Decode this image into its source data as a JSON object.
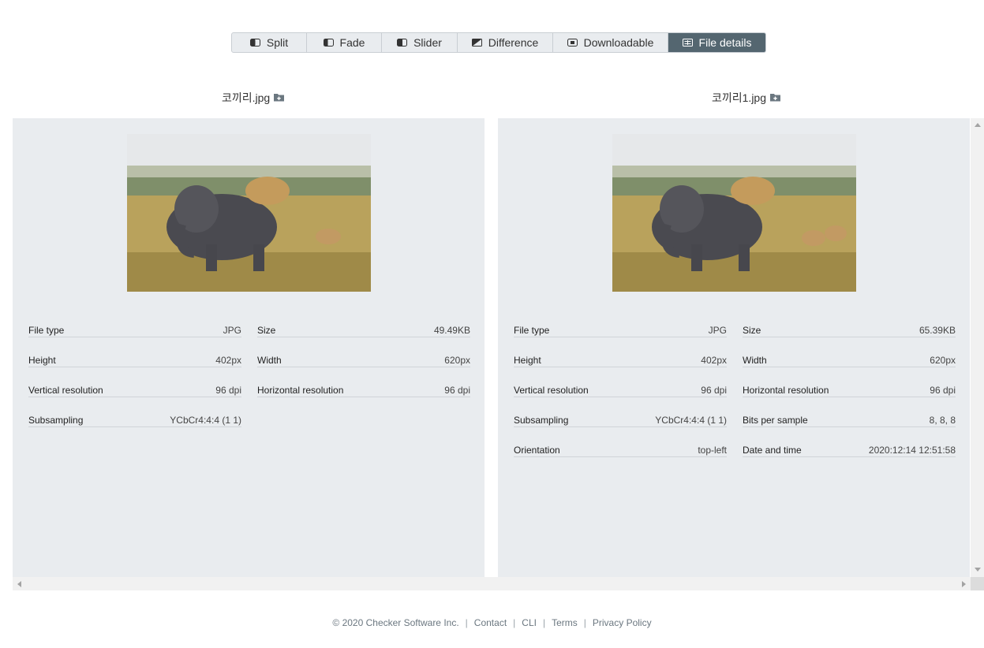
{
  "toolbar": {
    "tabs": [
      {
        "label": "Split",
        "icon": "split-icon"
      },
      {
        "label": "Fade",
        "icon": "fade-icon"
      },
      {
        "label": "Slider",
        "icon": "slider-icon"
      },
      {
        "label": "Difference",
        "icon": "difference-icon"
      },
      {
        "label": "Downloadable",
        "icon": "downloadable-icon"
      },
      {
        "label": "File details",
        "icon": "file-details-icon",
        "active": true
      }
    ],
    "active_color": "#546670"
  },
  "left": {
    "filename": "코끼리.jpg",
    "details": {
      "file_type": {
        "label": "File type",
        "value": "JPG"
      },
      "size": {
        "label": "Size",
        "value": "49.49KB"
      },
      "height": {
        "label": "Height",
        "value": "402px"
      },
      "width": {
        "label": "Width",
        "value": "620px"
      },
      "vres": {
        "label": "Vertical resolution",
        "value": "96 dpi"
      },
      "hres": {
        "label": "Horizontal resolution",
        "value": "96 dpi"
      },
      "subsampling": {
        "label": "Subsampling",
        "value": "YCbCr4:4:4 (1 1)"
      }
    }
  },
  "right": {
    "filename": "코끼리1.jpg",
    "details": {
      "file_type": {
        "label": "File type",
        "value": "JPG"
      },
      "size": {
        "label": "Size",
        "value": "65.39KB"
      },
      "height": {
        "label": "Height",
        "value": "402px"
      },
      "width": {
        "label": "Width",
        "value": "620px"
      },
      "vres": {
        "label": "Vertical resolution",
        "value": "96 dpi"
      },
      "hres": {
        "label": "Horizontal resolution",
        "value": "96 dpi"
      },
      "subsampling": {
        "label": "Subsampling",
        "value": "YCbCr4:4:4 (1 1)"
      },
      "bits": {
        "label": "Bits per sample",
        "value": "8, 8, 8"
      },
      "orientation": {
        "label": "Orientation",
        "value": "top-left"
      },
      "datetime": {
        "label": "Date and time",
        "value": "2020:12:14 12:51:58"
      }
    }
  },
  "footer": {
    "copyright": "© 2020 Checker Software Inc.",
    "links": [
      "Contact",
      "CLI",
      "Terms",
      "Privacy Policy"
    ]
  }
}
